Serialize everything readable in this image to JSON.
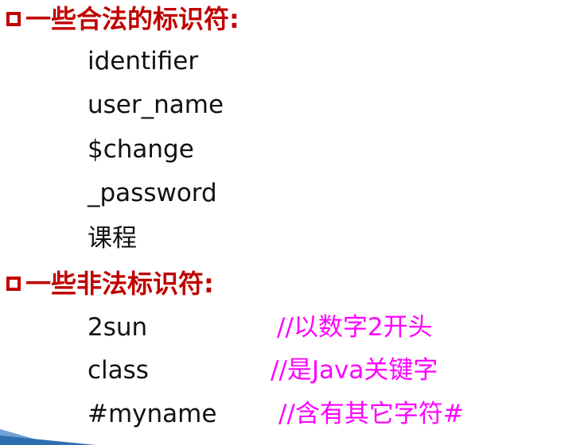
{
  "legal_heading": "一些合法的标识符:",
  "legal_items": [
    "identifier",
    "user_name",
    "$change",
    "_password",
    "课程"
  ],
  "illegal_heading": "一些非法标识符:",
  "illegal_items": [
    {
      "name": "2sun",
      "comment": "//以数字2开头"
    },
    {
      "name": "class",
      "comment": "//是Java关键字"
    },
    {
      "name": "#myname",
      "comment": "//含有其它字符#"
    }
  ],
  "colors": {
    "heading": "#c00000",
    "comment": "#ff00ff",
    "text": "#111111"
  }
}
